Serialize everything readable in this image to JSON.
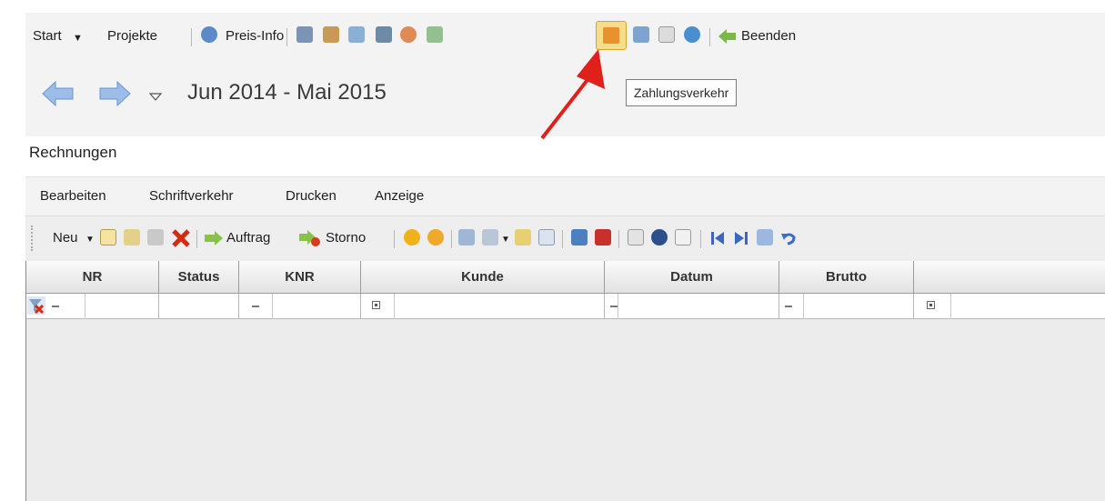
{
  "menu_top": {
    "start": "Start",
    "projekte": "Projekte",
    "preis_info": "Preis-Info",
    "beenden": "Beenden"
  },
  "date_nav": {
    "range": "Jun 2014 - Mai 2015"
  },
  "tooltip": "Zahlungsverkehr",
  "section_title": "Rechnungen",
  "menubar": [
    "Bearbeiten",
    "Schriftverkehr",
    "Drucken",
    "Anzeige"
  ],
  "toolbar2": {
    "neu": "Neu",
    "auftrag": "Auftrag",
    "storno": "Storno"
  },
  "grid": {
    "columns": [
      "NR",
      "Status",
      "KNR",
      "Kunde",
      "Datum",
      "Brutto"
    ]
  },
  "colors": {
    "arrow": "#e0201a",
    "highlight": "#f3d46d"
  }
}
